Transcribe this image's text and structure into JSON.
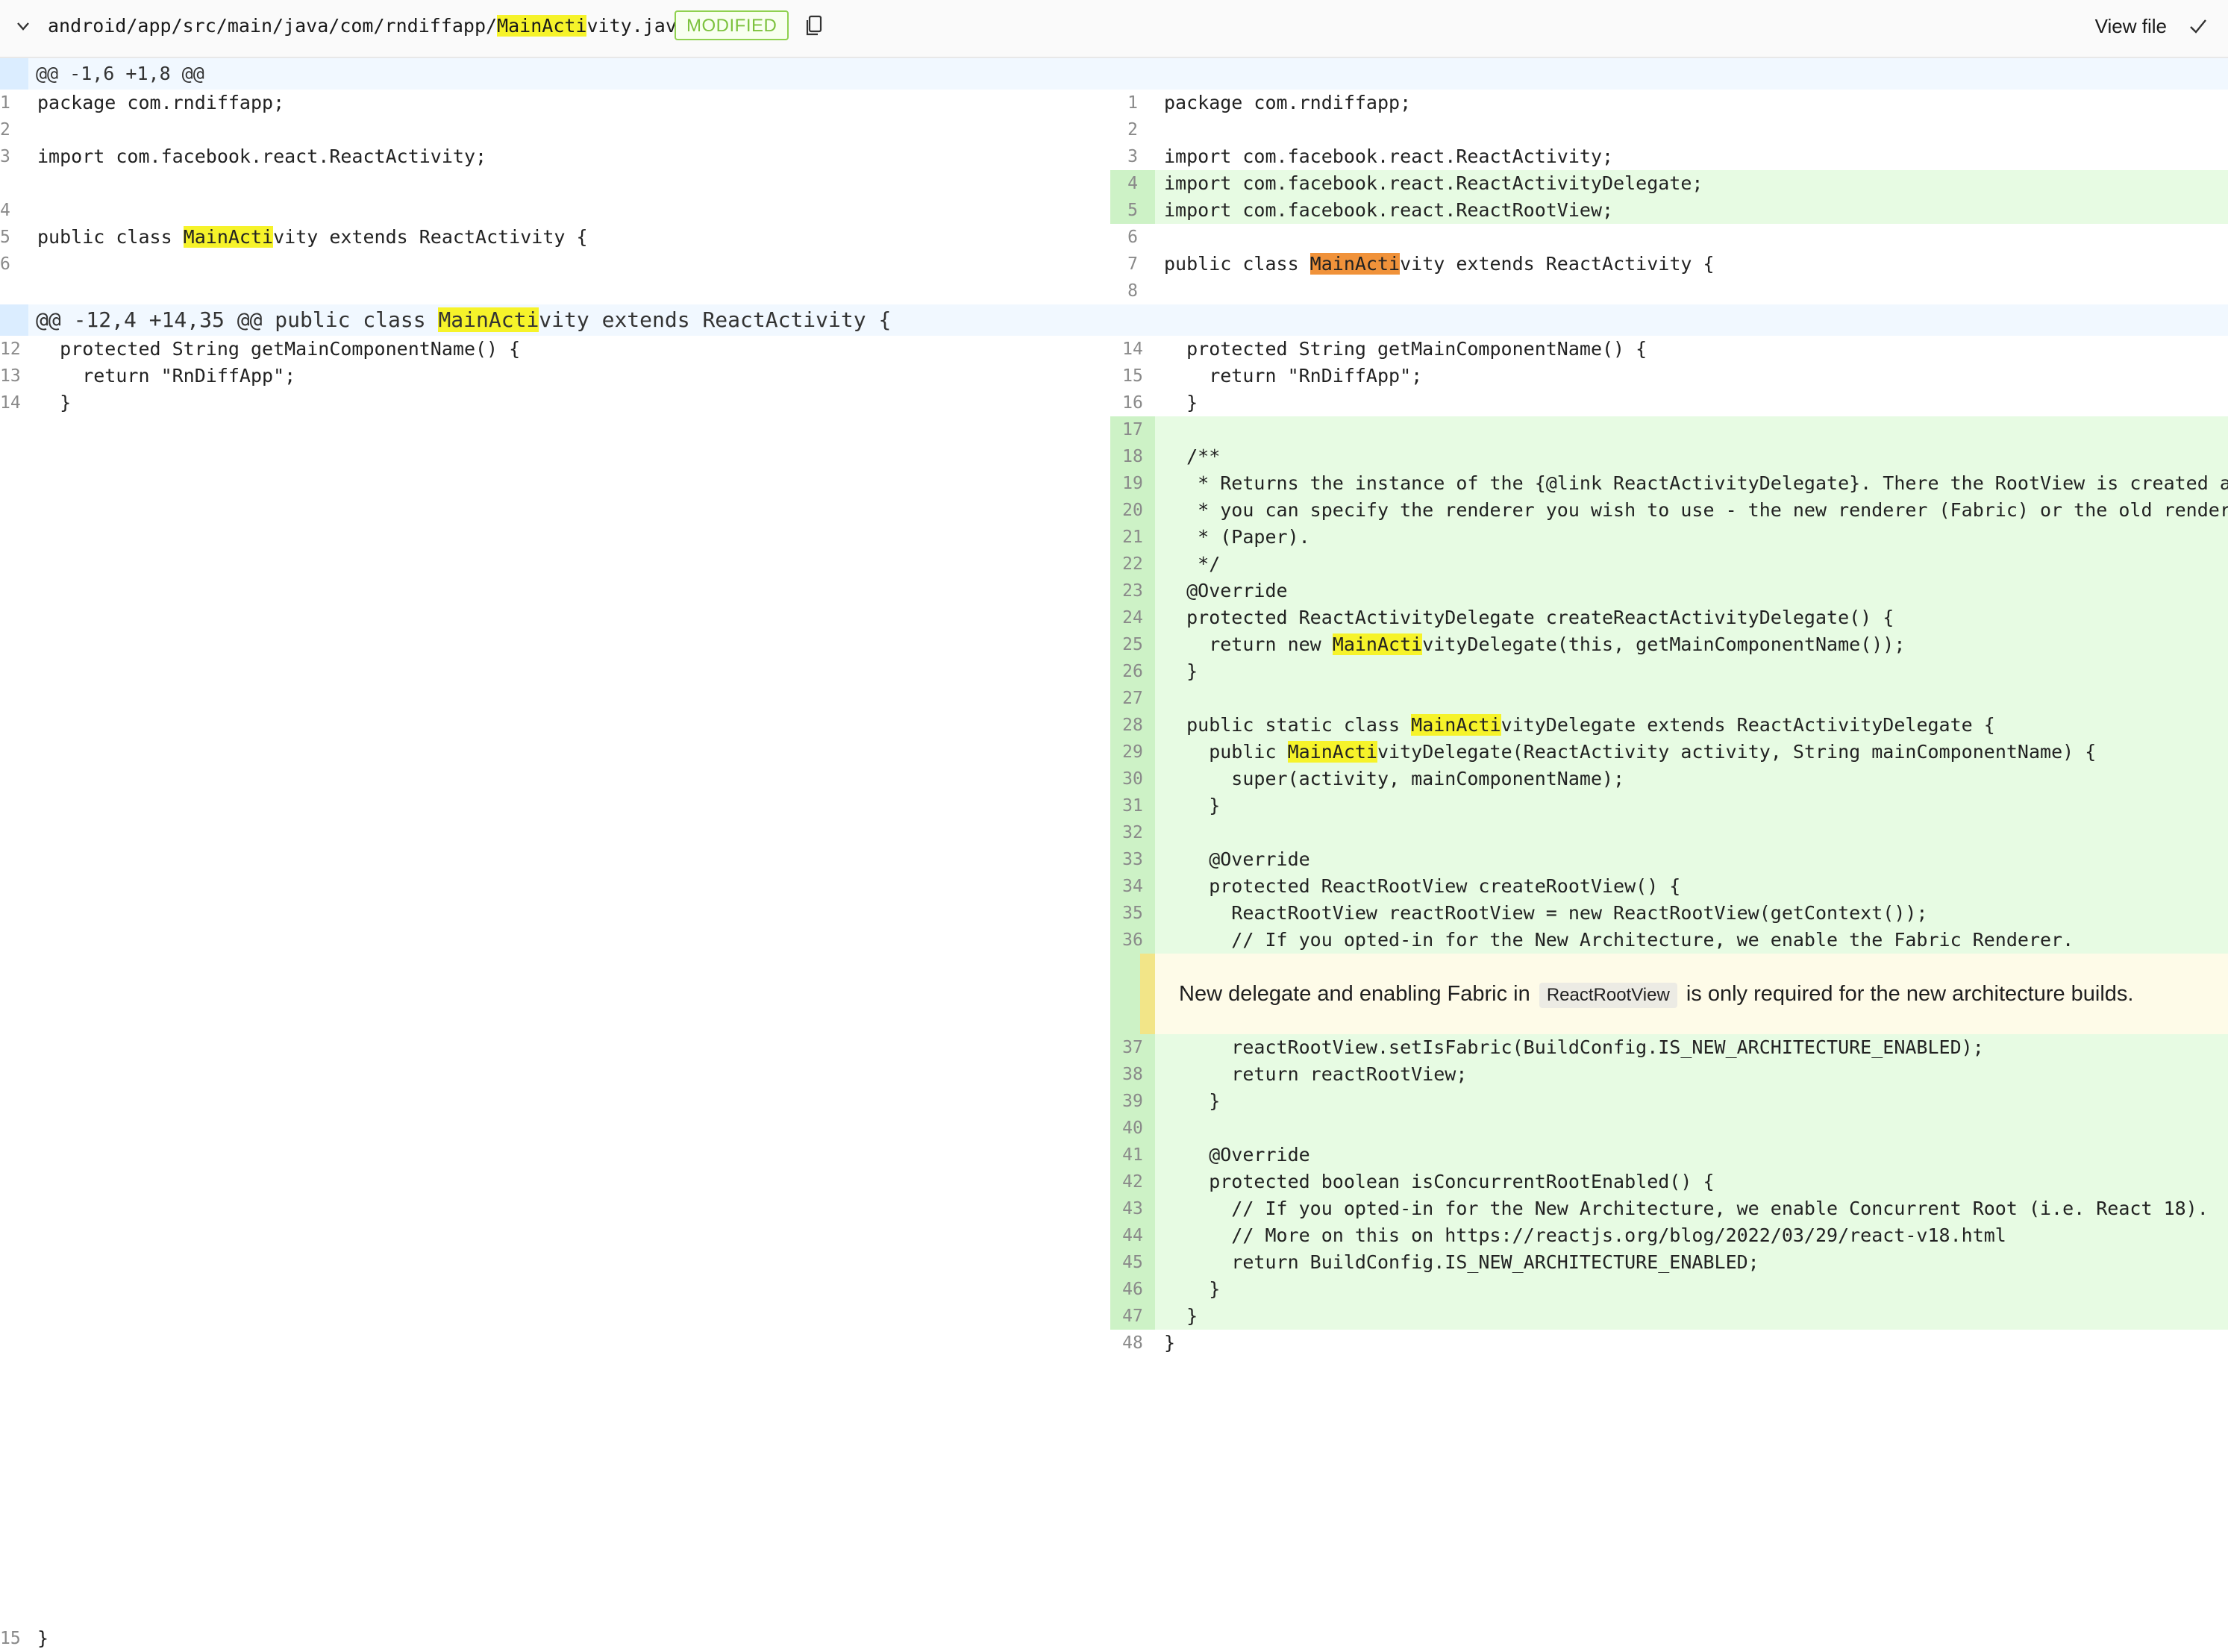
{
  "header": {
    "path_prefix": "android/app/src/main/java/com/rndiffapp/",
    "path_match": "MainActi",
    "path_suffix": "vity.java",
    "status_tag": "MODIFIED",
    "view_file_label": "View file",
    "icons": [
      "chevron-down-icon",
      "copy-icon",
      "checkmark-icon"
    ],
    "highlight_color": "#f6f32a",
    "active_match_color": "#f0923a"
  },
  "hunk1": {
    "text": "@@ -1,6 +1,8 @@"
  },
  "hunk2": {
    "prefix": "@@ -12,4 +14,35 @@ public class ",
    "match": "MainActi",
    "suffix": "vity extends ReactActivity {"
  },
  "left_lines": [
    {
      "num": "1",
      "code": "package com.rndiffapp;"
    },
    {
      "num": "2",
      "code": ""
    },
    {
      "num": "3",
      "code": "import com.facebook.react.ReactActivity;"
    },
    {
      "num": "4",
      "code": ""
    },
    {
      "num": "5",
      "pre": "public class ",
      "match": "MainActi",
      "post": "vity extends ReactActivity {"
    },
    {
      "num": "6",
      "code": ""
    },
    {
      "num": "12",
      "code": "  protected String getMainComponentName() {"
    },
    {
      "num": "13",
      "code": "    return \"RnDiffApp\";"
    },
    {
      "num": "14",
      "code": "  }"
    },
    {
      "num": "15",
      "code": "}"
    }
  ],
  "right_lines": [
    {
      "num": "1",
      "code": "package com.rndiffapp;"
    },
    {
      "num": "2",
      "code": ""
    },
    {
      "num": "3",
      "code": "import com.facebook.react.ReactActivity;"
    },
    {
      "num": "4",
      "code": "import com.facebook.react.ReactActivityDelegate;",
      "added": true
    },
    {
      "num": "5",
      "code": "import com.facebook.react.ReactRootView;",
      "added": true
    },
    {
      "num": "6",
      "code": ""
    },
    {
      "num": "7",
      "pre": "public class ",
      "match": "MainActi",
      "post": "vity extends ReactActivity {"
    },
    {
      "num": "8",
      "code": ""
    },
    {
      "num": "14",
      "code": "  protected String getMainComponentName() {"
    },
    {
      "num": "15",
      "code": "    return \"RnDiffApp\";"
    },
    {
      "num": "16",
      "code": "  }"
    },
    {
      "num": "17",
      "code": "",
      "added": true
    },
    {
      "num": "18",
      "code": "  /**",
      "added": true
    },
    {
      "num": "19",
      "code": "   * Returns the instance of the {@link ReactActivityDelegate}. There the RootView is created and",
      "added": true
    },
    {
      "num": "20",
      "code": "   * you can specify the renderer you wish to use - the new renderer (Fabric) or the old renderer",
      "added": true
    },
    {
      "num": "21",
      "code": "   * (Paper).",
      "added": true
    },
    {
      "num": "22",
      "code": "   */",
      "added": true
    },
    {
      "num": "23",
      "code": "  @Override",
      "added": true
    },
    {
      "num": "24",
      "code": "  protected ReactActivityDelegate createReactActivityDelegate() {",
      "added": true
    },
    {
      "num": "25",
      "pre": "    return new ",
      "match": "MainActi",
      "post": "vityDelegate(this, getMainComponentName());",
      "added": true
    },
    {
      "num": "26",
      "code": "  }",
      "added": true
    },
    {
      "num": "27",
      "code": "",
      "added": true
    },
    {
      "num": "28",
      "pre": "  public static class ",
      "match": "MainActi",
      "post": "vityDelegate extends ReactActivityDelegate {",
      "added": true
    },
    {
      "num": "29",
      "pre": "    public ",
      "match": "MainActi",
      "post": "vityDelegate(ReactActivity activity, String mainComponentName) {",
      "added": true
    },
    {
      "num": "30",
      "code": "      super(activity, mainComponentName);",
      "added": true
    },
    {
      "num": "31",
      "code": "    }",
      "added": true
    },
    {
      "num": "32",
      "code": "",
      "added": true
    },
    {
      "num": "33",
      "code": "    @Override",
      "added": true
    },
    {
      "num": "34",
      "code": "    protected ReactRootView createRootView() {",
      "added": true
    },
    {
      "num": "35",
      "code": "      ReactRootView reactRootView = new ReactRootView(getContext());",
      "added": true
    },
    {
      "num": "36",
      "code": "      // If you opted-in for the New Architecture, we enable the Fabric Renderer.",
      "added": true
    },
    {
      "num": "37",
      "code": "      reactRootView.setIsFabric(BuildConfig.IS_NEW_ARCHITECTURE_ENABLED);",
      "added": true
    },
    {
      "num": "38",
      "code": "      return reactRootView;",
      "added": true
    },
    {
      "num": "39",
      "code": "    }",
      "added": true
    },
    {
      "num": "40",
      "code": "",
      "added": true
    },
    {
      "num": "41",
      "code": "    @Override",
      "added": true
    },
    {
      "num": "42",
      "code": "    protected boolean isConcurrentRootEnabled() {",
      "added": true
    },
    {
      "num": "43",
      "code": "      // If you opted-in for the New Architecture, we enable Concurrent Root (i.e. React 18).",
      "added": true
    },
    {
      "num": "44",
      "code": "      // More on this on https://reactjs.org/blog/2022/03/29/react-v18.html",
      "added": true
    },
    {
      "num": "45",
      "code": "      return BuildConfig.IS_NEW_ARCHITECTURE_ENABLED;",
      "added": true
    },
    {
      "num": "46",
      "code": "    }",
      "added": true
    },
    {
      "num": "47",
      "code": "  }",
      "added": true
    },
    {
      "num": "48",
      "code": "}"
    }
  ],
  "comment": {
    "before": "New delegate and enabling Fabric in ",
    "code": "ReactRootView",
    "after": " is only required for the new architecture builds."
  }
}
